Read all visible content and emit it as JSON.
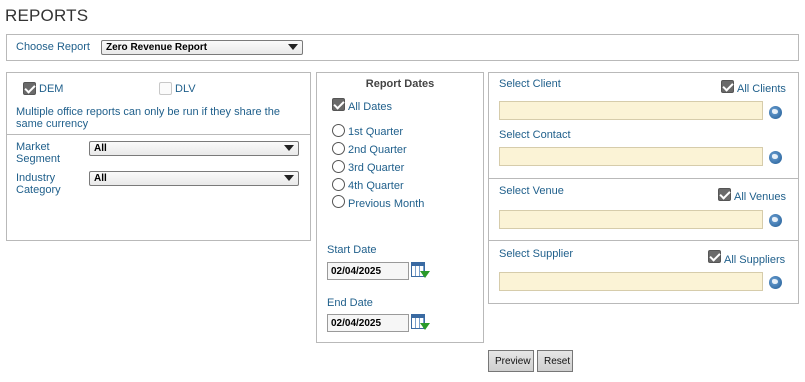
{
  "page": {
    "title": "REPORTS"
  },
  "header": {
    "choose_report_label": "Choose Report",
    "report_select_value": "Zero Revenue Report"
  },
  "left": {
    "dem_label": "DEM",
    "dem_checked": true,
    "dlv_label": "DLV",
    "dlv_checked": false,
    "info": "Multiple office reports can only be run if they share the same currency",
    "market_segment_line1": "Market",
    "market_segment_line2": "Segment",
    "market_segment_value": "All",
    "industry_category_line1": "Industry",
    "industry_category_line2": "Category",
    "industry_category_value": "All"
  },
  "dates": {
    "heading": "Report Dates",
    "all_dates_label": "All Dates",
    "all_dates_checked": true,
    "radios": [
      "1st Quarter",
      "2nd Quarter",
      "3rd Quarter",
      "4th Quarter",
      "Previous Month"
    ],
    "start_label": "Start Date",
    "start_value": "02/04/2025",
    "end_label": "End Date",
    "end_value": "02/04/2025"
  },
  "right": {
    "client_label": "Select Client",
    "all_clients_label": "All Clients",
    "contact_label": "Select Contact",
    "venue_label": "Select Venue",
    "all_venues_label": "All Venues",
    "supplier_label": "Select Supplier",
    "all_suppliers_label": "All Suppliers"
  },
  "actions": {
    "preview_label": "Preview",
    "reset_label": "Reset"
  }
}
